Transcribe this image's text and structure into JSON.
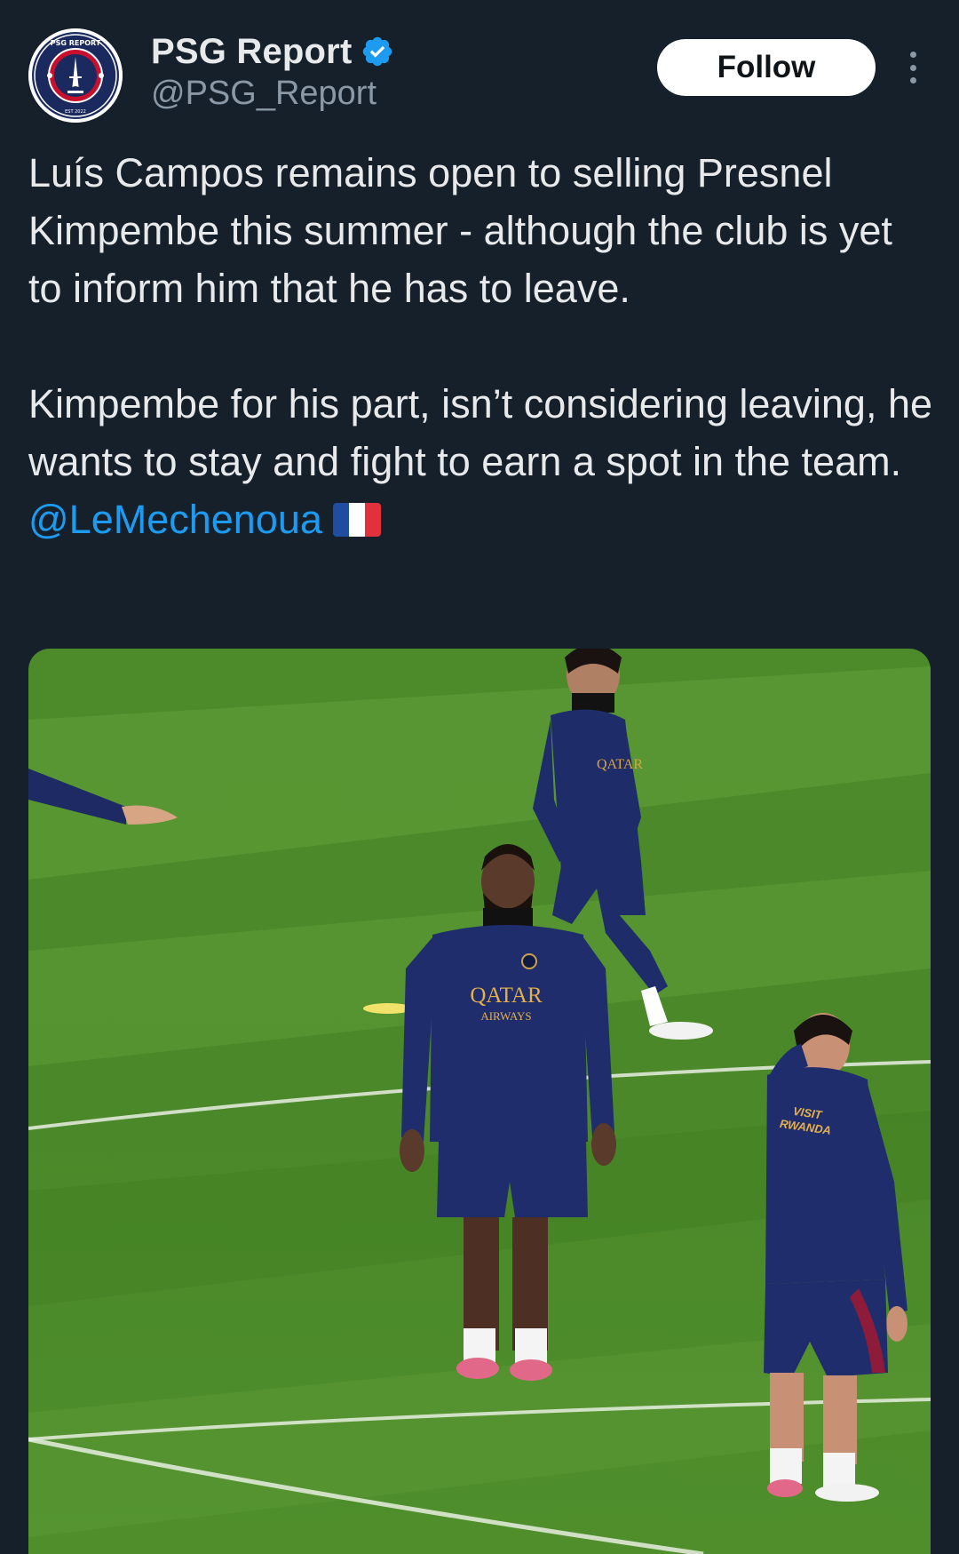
{
  "author": {
    "display_name": "PSG Report",
    "handle": "@PSG_Report",
    "avatar_text_top": "PSG REPORT",
    "avatar_text_bottom": "EST 2022",
    "verified": true
  },
  "actions": {
    "follow_label": "Follow"
  },
  "tweet": {
    "paragraph1": "Luís Campos remains open to selling Presnel Kimpembe this summer - although the club is yet to inform him that he has to leave.",
    "paragraph2_text": "Kimpembe for his part, isn’t considering leaving, he wants to stay and fight to earn a spot in the team. ",
    "mention": "@LeMechenoua",
    "flag_icon": "france-flag-icon"
  },
  "media": {
    "jersey_sponsor_top": "QATAR",
    "jersey_sponsor_bottom": "AIRWAYS",
    "sleeve_text_line1": "VISIT",
    "sleeve_text_line2": "RWANDA"
  },
  "colors": {
    "background": "#15202b",
    "accent": "#1d9bf0",
    "text": "#e7e9ea",
    "secondary_text": "#8b98a5"
  }
}
